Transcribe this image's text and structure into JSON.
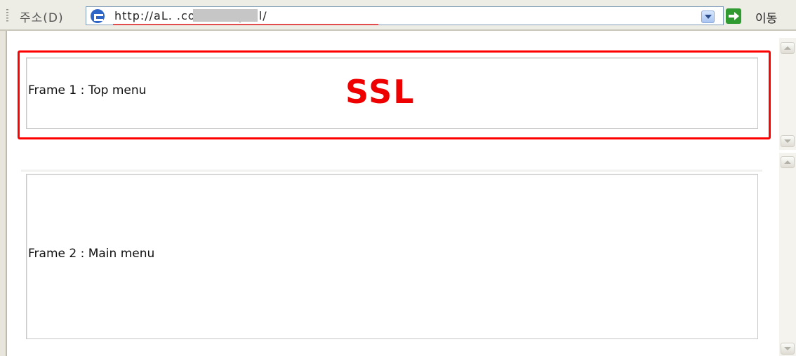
{
  "address_bar": {
    "label": "주소(D)",
    "url": "http://aL.             .co.kr/easyssl/",
    "go_label": "이동"
  },
  "frames": {
    "frame1_label": "Frame 1 : Top menu",
    "frame2_label": "Frame 2 : Main menu"
  },
  "annotation": {
    "ssl_label": "SSL",
    "color": "#ee0000"
  },
  "icons": {
    "page": "ie-page-icon",
    "dropdown": "chevron-down-icon",
    "go": "go-arrow-icon"
  }
}
